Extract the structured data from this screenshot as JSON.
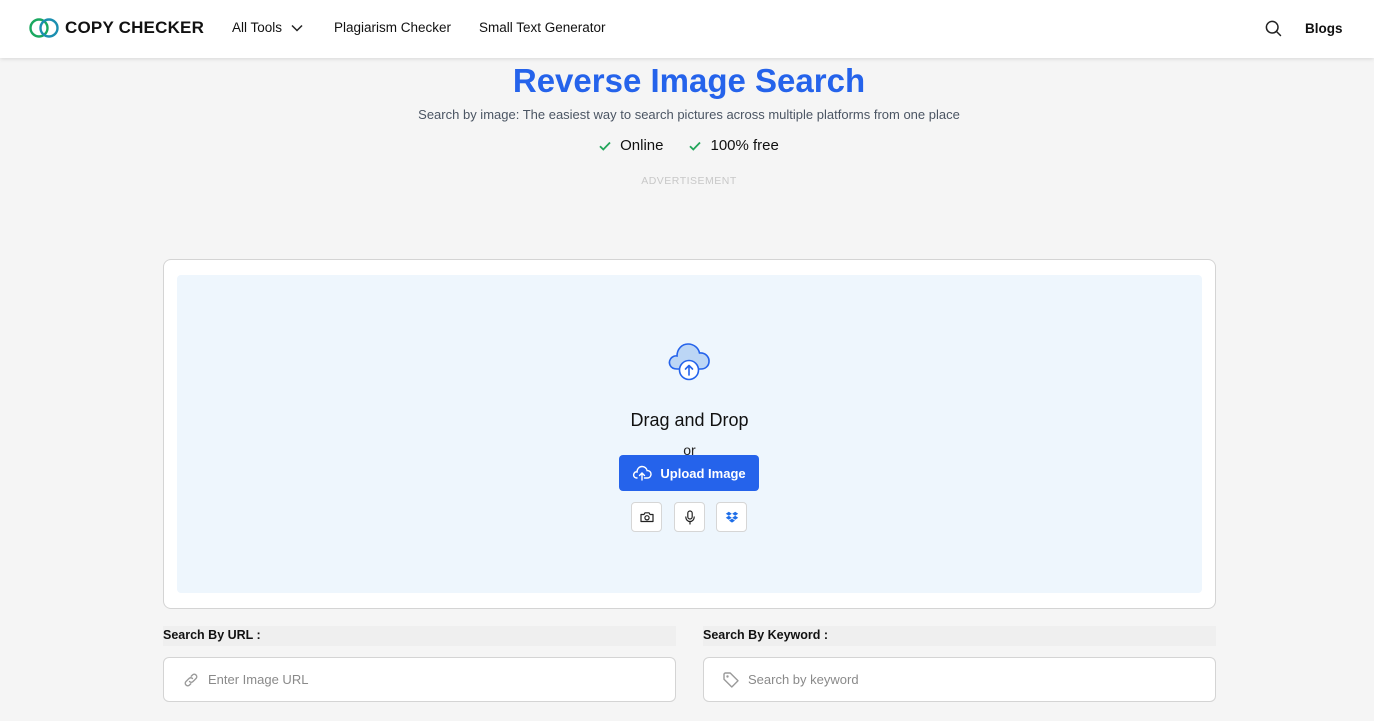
{
  "header": {
    "logo_text": "COPY CHECKER",
    "nav": [
      {
        "label": "All Tools"
      },
      {
        "label": "Plagiarism Checker"
      },
      {
        "label": "Small Text Generator"
      }
    ],
    "blogs_label": "Blogs",
    "icons": {
      "search": "search-icon",
      "chevron": "chevron-down-icon"
    }
  },
  "hero": {
    "title": "Reverse Image Search",
    "subtitle": "Search by image: The easiest way to search pictures across multiple platforms from one place",
    "features": [
      {
        "label": "Online"
      },
      {
        "label": "100% free"
      }
    ],
    "ad_label": "ADVERTISEMENT"
  },
  "upload": {
    "title": "Drag and Drop",
    "or_text": "or",
    "button_label": "Upload Image",
    "tools": [
      "camera-icon",
      "microphone-icon",
      "dropbox-icon"
    ]
  },
  "search_url": {
    "label": "Search By URL :",
    "placeholder": "Enter Image URL"
  },
  "search_keyword": {
    "label": "Search By Keyword :",
    "placeholder": "Search by keyword"
  },
  "colors": {
    "brand_blue": "#2563eb",
    "check_green": "#22a55a",
    "dropzone_bg": "#eef6fd",
    "logo_green": "#1aa860",
    "logo_teal": "#1b8fb0"
  }
}
